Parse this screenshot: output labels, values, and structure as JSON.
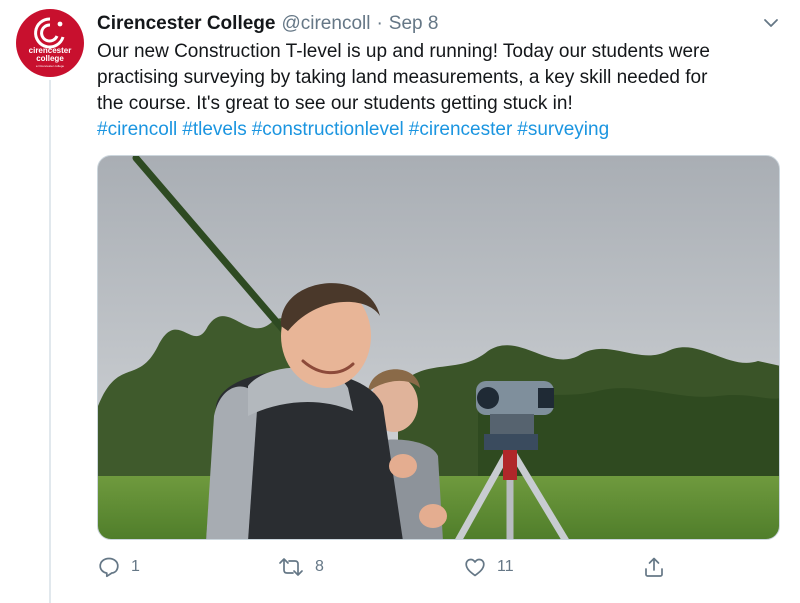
{
  "tweet": {
    "author_name": "Cirencester College",
    "handle": "@cirencoll",
    "separator": "·",
    "date": "Sep 8",
    "lines": [
      "Our new Construction T-level is up and running! Today our students were",
      "practising surveying by taking land measurements, a key skill needed for",
      "the course. It's great to see our students getting stuck in!"
    ],
    "hashtags": [
      "#cirencoll",
      "#tlevels",
      "#constructionlevel",
      "#cirencester",
      "#surveying"
    ]
  },
  "avatar": {
    "line1": "cirencester",
    "line2": "college",
    "line3": "a Cirencester college",
    "brand_color": "#c8102e"
  },
  "actions": {
    "reply_count": "1",
    "retweet_count": "8",
    "like_count": "11"
  },
  "icons": {
    "more": "chevron-down-icon",
    "reply": "reply-icon",
    "retweet": "retweet-icon",
    "like": "heart-icon",
    "share": "share-icon"
  },
  "colors": {
    "text": "#14171a",
    "muted": "#657786",
    "link": "#1b95e0",
    "border": "#e1e8ed"
  }
}
